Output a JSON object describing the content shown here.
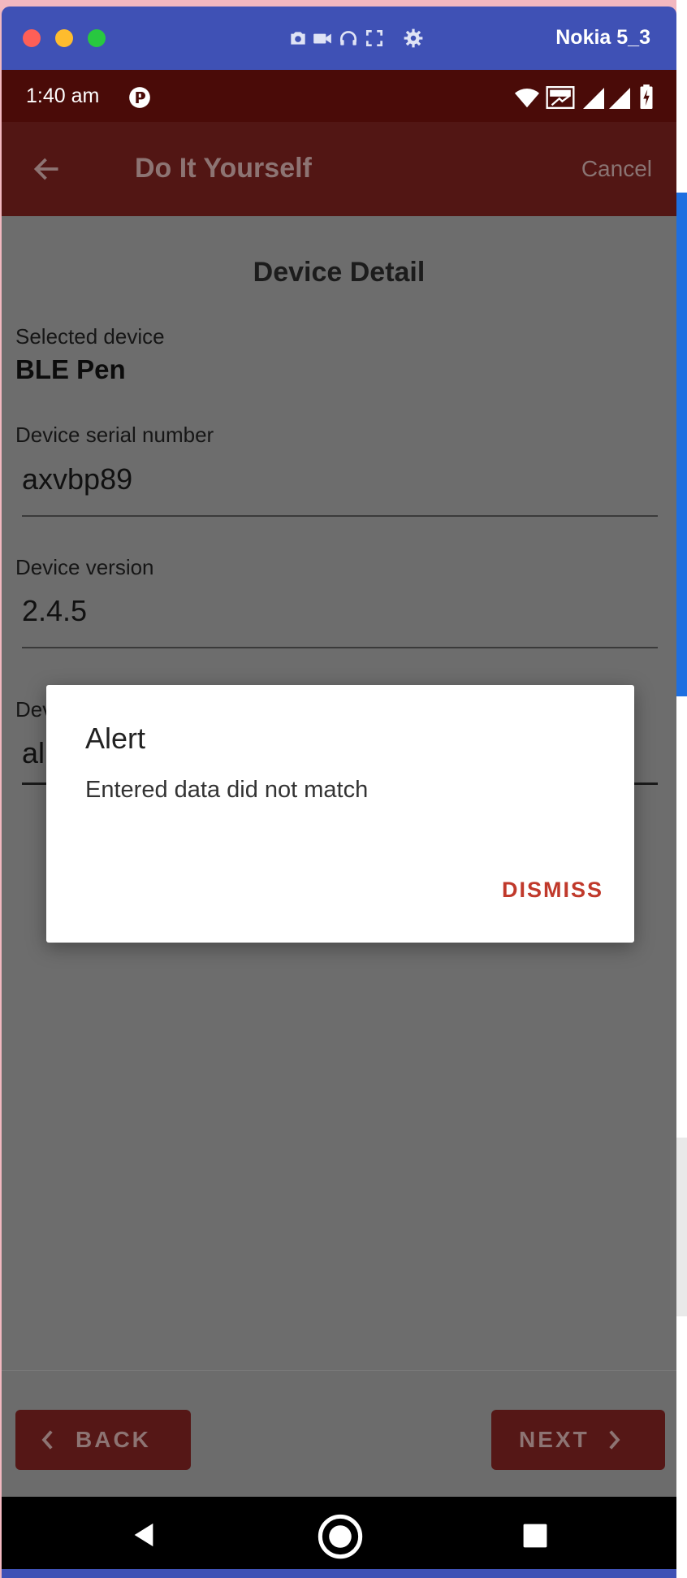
{
  "window": {
    "device_name": "Nokia 5_3"
  },
  "status_bar": {
    "time": "1:40 am"
  },
  "app_bar": {
    "title": "Do It Yourself",
    "cancel_label": "Cancel"
  },
  "content": {
    "section_title": "Device Detail",
    "selected_device_label": "Selected device",
    "selected_device_value": "BLE Pen",
    "serial_label": "Device serial number",
    "serial_value": "axvbp89",
    "version_label": "Device version",
    "version_value": "2.4.5",
    "third_label_partial": "Dev",
    "third_value_partial": "al"
  },
  "dialog": {
    "title": "Alert",
    "message": "Entered data did not match",
    "dismiss_label": "DISMISS"
  },
  "footer": {
    "back_label": "BACK",
    "next_label": "NEXT"
  },
  "colors": {
    "app_bar": "#521614",
    "status_bar": "#4a0b08",
    "dismiss": "#c0392b",
    "emulator_frame": "#3f51b5"
  }
}
